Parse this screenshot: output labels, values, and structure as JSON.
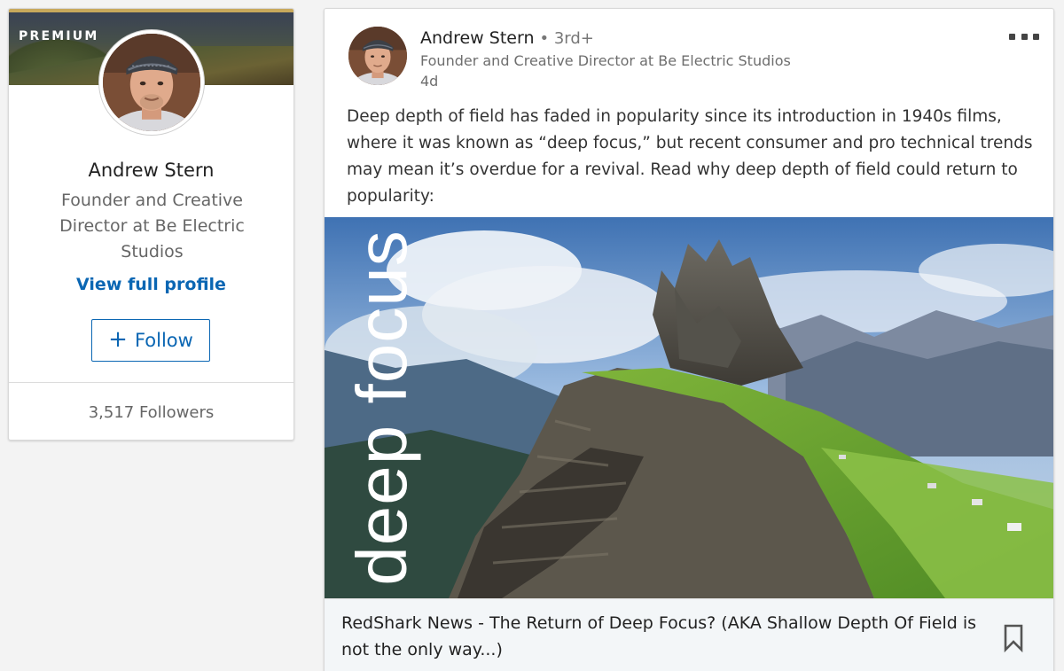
{
  "profile": {
    "badge": "PREMIUM",
    "name": "Andrew Stern",
    "headline": "Founder and Creative Director at Be Electric Studios",
    "view_profile": "View full profile",
    "follow_label": "Follow",
    "followers": "3,517 Followers"
  },
  "post": {
    "author": "Andrew Stern",
    "degree": "• 3rd+",
    "author_headline": "Founder and Creative Director at Be Electric Studios",
    "time": "4d",
    "text": "Deep depth of field has faded in popularity since its introduction in 1940s films, where it was known as “deep focus,” but recent consumer and pro technical trends may mean it’s overdue for a revival. Read why deep depth of field could return to popularity:",
    "image_overlay": "deep focus",
    "link_title": "RedShark News - The Return of Deep Focus? (AKA Shallow Depth Of Field is not the only way...)"
  },
  "icons": {
    "more": "more-horizontal-icon",
    "bookmark": "bookmark-icon",
    "plus": "plus-icon"
  },
  "colors": {
    "link_blue": "#0a66b3",
    "premium_gold": "#c8a85c"
  }
}
